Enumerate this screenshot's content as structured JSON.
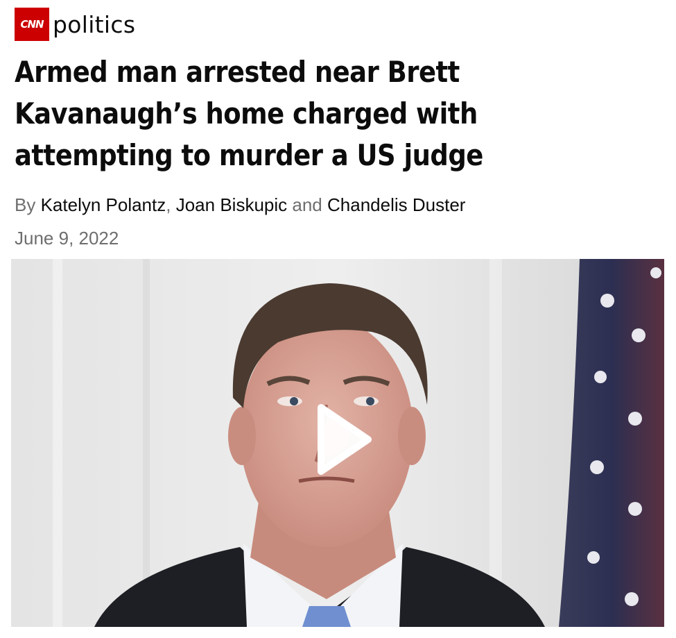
{
  "brand": {
    "logo_text": "CNN",
    "section": "politics"
  },
  "article": {
    "headline": "Armed man arrested near Brett Kavanaugh’s home charged with attempting to murder a US judge",
    "byline": {
      "prefix": "By",
      "authors": [
        "Katelyn Polantz",
        "Joan Biskupic",
        "Chandelis Duster"
      ],
      "separator": ",",
      "conjunction": "and"
    },
    "date": "June 9, 2022"
  },
  "video": {
    "play_icon": "play-icon"
  },
  "colors": {
    "brand_red": "#cc0000",
    "text": "#0c0c0c",
    "muted": "#6e6e6e"
  }
}
